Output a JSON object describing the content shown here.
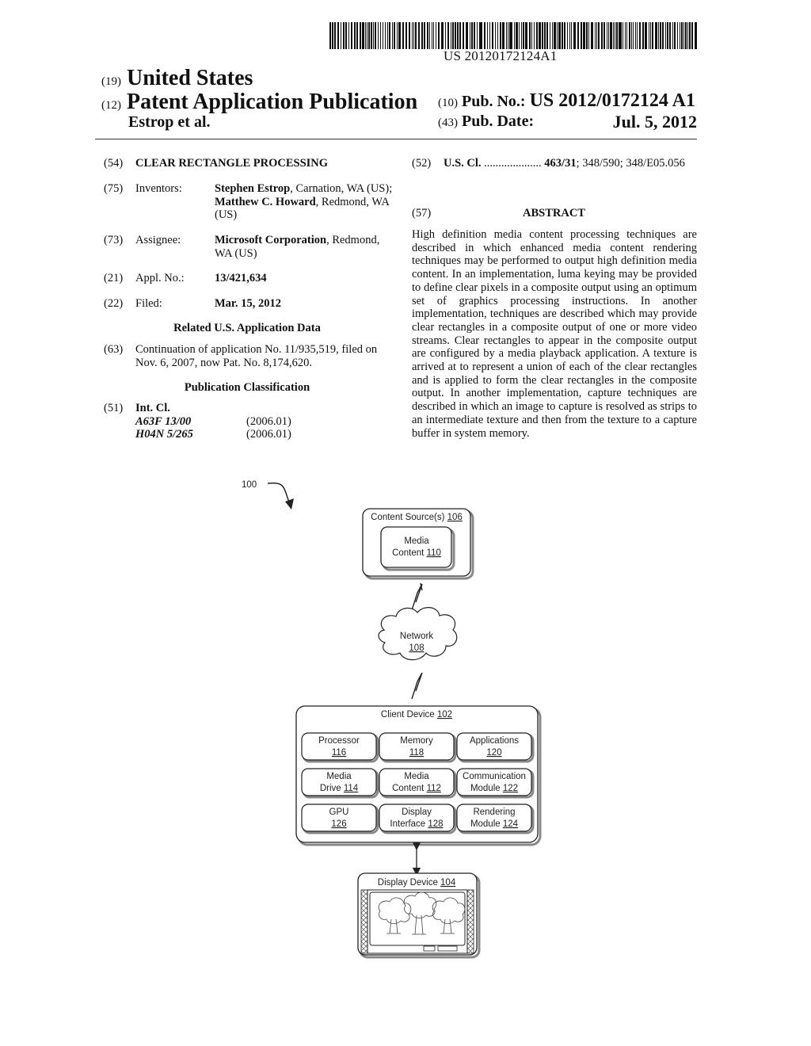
{
  "barcode": {
    "text": "US 20120172124A1"
  },
  "header": {
    "country_code": "(19)",
    "country": "United States",
    "type_code": "(12)",
    "type": "Patent Application Publication",
    "authors": "Estrop et al.",
    "pub_no_code": "(10)",
    "pub_no_label": "Pub. No.:",
    "pub_no": "US 2012/0172124 A1",
    "pub_date_code": "(43)",
    "pub_date_label": "Pub. Date:",
    "pub_date": "Jul. 5, 2012"
  },
  "biblio": {
    "title": {
      "code": "(54)",
      "value": "CLEAR RECTANGLE PROCESSING"
    },
    "inventors": {
      "code": "(75)",
      "label": "Inventors:",
      "name1": "Stephen Estrop",
      "loc1": ", Carnation, WA (US); ",
      "name2": "Matthew C. Howard",
      "loc2": ", Redmond, WA (US)"
    },
    "assignee": {
      "code": "(73)",
      "label": "Assignee:",
      "name": "Microsoft Corporation",
      "loc": ", Redmond, WA (US)"
    },
    "appl_no": {
      "code": "(21)",
      "label": "Appl. No.:",
      "value": "13/421,634"
    },
    "filed": {
      "code": "(22)",
      "label": "Filed:",
      "value": "Mar. 15, 2012"
    },
    "related_heading": "Related U.S. Application Data",
    "continuation": {
      "code": "(63)",
      "text": "Continuation of application No. 11/935,519, filed on Nov. 6, 2007, now Pat. No. 8,174,620."
    },
    "classification_heading": "Publication Classification",
    "int_cl": {
      "code": "(51)",
      "label": "Int. Cl.",
      "entries": [
        {
          "class": "A63F 13/00",
          "version": "(2006.01)"
        },
        {
          "class": "H04N 5/265",
          "version": "(2006.01)"
        }
      ]
    },
    "us_cl": {
      "code": "(52)",
      "label": "U.S. Cl.",
      "dots": " ....................  ",
      "primary": "463/31",
      "rest": "; 348/590; 348/E05.056"
    }
  },
  "abstract": {
    "code": "(57)",
    "heading": "ABSTRACT",
    "text": "High definition media content processing techniques are described in which enhanced media content rendering techniques may be performed to output high definition media content. In an implementation, luma keying may be provided to define clear pixels in a composite output using an optimum set of graphics processing instructions. In another implementation, techniques are described which may provide clear rectangles in a composite output of one or more video streams. Clear rectangles to appear in the composite output are configured by a media playback application. A texture is arrived at to represent a union of each of the clear rectangles and is applied to form the clear rectangles in the composite output. In another implementation, capture techniques are described in which an image to capture is resolved as strips to an intermediate texture and then from the texture to a capture buffer in system memory."
  },
  "diagram": {
    "figure_ref": "100",
    "content_source": {
      "label": "Content Source(s) ",
      "ref": "106"
    },
    "media_content_src": {
      "line1": "Media",
      "line2": "Content ",
      "ref": "110"
    },
    "network": {
      "label": "Network",
      "ref": "108"
    },
    "client_device": {
      "label": "Client Device ",
      "ref": "102"
    },
    "modules": [
      {
        "line1": "Processor",
        "line2": "",
        "ref": "116"
      },
      {
        "line1": "Memory",
        "line2": "",
        "ref": "118"
      },
      {
        "line1": "Applications",
        "line2": "",
        "ref": "120"
      },
      {
        "line1": "Media",
        "line2": "Drive ",
        "ref": "114"
      },
      {
        "line1": "Media",
        "line2": "Content ",
        "ref": "112"
      },
      {
        "line1": "Communication",
        "line2": "Module  ",
        "ref": "122"
      },
      {
        "line1": "GPU",
        "line2": "",
        "ref": "126"
      },
      {
        "line1": "Display",
        "line2": "Interface ",
        "ref": "128"
      },
      {
        "line1": "Rendering",
        "line2": "Module ",
        "ref": "124"
      }
    ],
    "display_device": {
      "label": "Display Device ",
      "ref": "104"
    }
  }
}
